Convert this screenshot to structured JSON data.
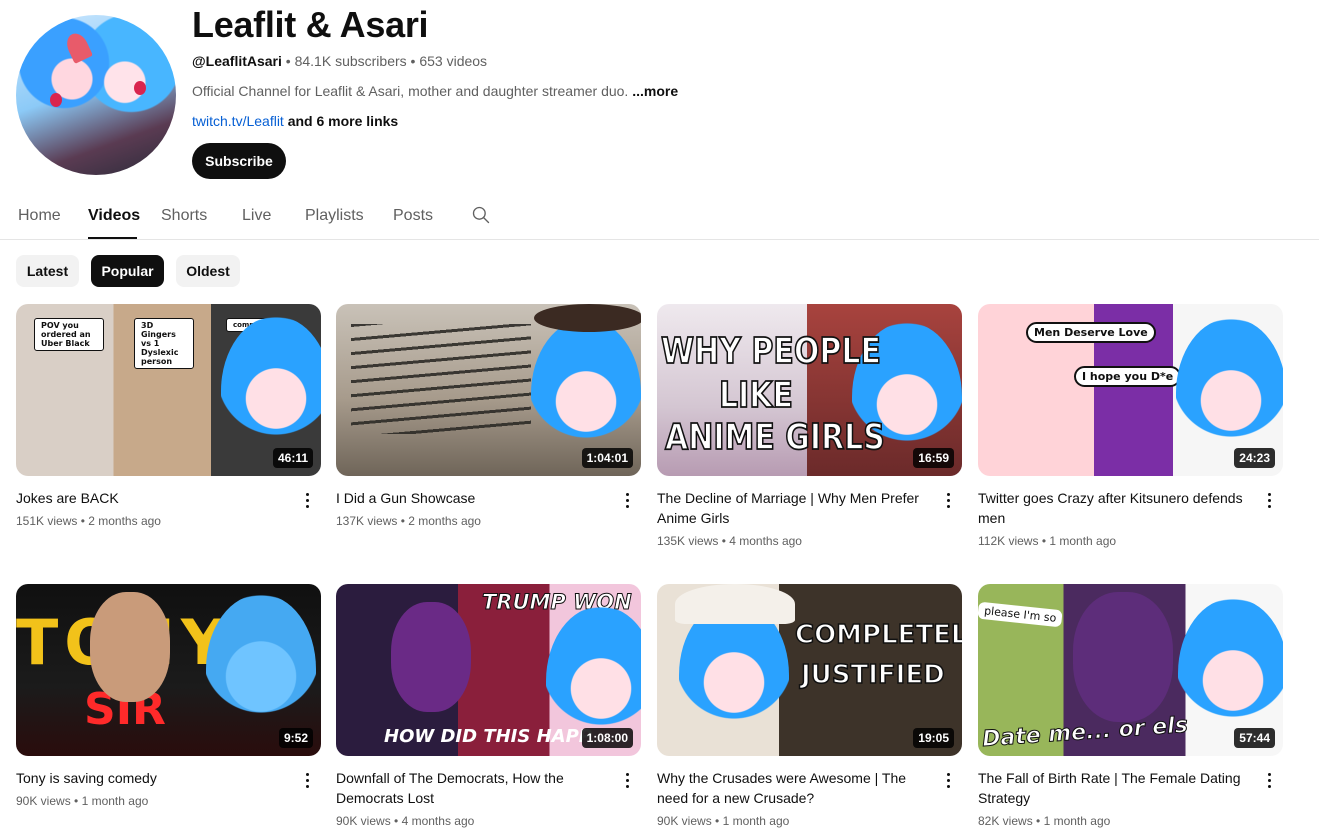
{
  "channel": {
    "name": "Leaflit & Asari",
    "handle": "@LeaflitAsari",
    "subscribers": "84.1K subscribers",
    "videos_count": "653 videos",
    "separator": " • ",
    "description": "Official Channel for Leaflit & Asari, mother and daughter streamer duo.",
    "more_label": "...more",
    "link_text": "twitch.tv/Leaflit",
    "more_links": " and 6 more links",
    "subscribe_label": "Subscribe"
  },
  "tabs": [
    {
      "label": "Home"
    },
    {
      "label": "Videos",
      "active": true
    },
    {
      "label": "Shorts"
    },
    {
      "label": "Live"
    },
    {
      "label": "Playlists"
    },
    {
      "label": "Posts"
    }
  ],
  "chips": [
    {
      "label": "Latest"
    },
    {
      "label": "Popular",
      "active": true
    },
    {
      "label": "Oldest"
    }
  ],
  "videos": [
    {
      "title": "Jokes are BACK",
      "views": "151K views",
      "age": "2 months ago",
      "duration": "46:11",
      "thumb_text": [
        "POV you ordered an Uber Black",
        "3D Gingers vs 1 Dyslexic person",
        "companie pointless"
      ]
    },
    {
      "title": "I Did a Gun Showcase",
      "views": "137K views",
      "age": "2 months ago",
      "duration": "1:04:01"
    },
    {
      "title": "The Decline of Marriage | Why Men Prefer Anime Girls",
      "views": "135K views",
      "age": "4 months ago",
      "duration": "16:59",
      "thumb_text": [
        "WHY PEOPLE",
        "LIKE",
        "ANIME GIRLS"
      ]
    },
    {
      "title": "Twitter goes Crazy after Kitsunero defends men",
      "views": "112K views",
      "age": "1 month ago",
      "duration": "24:23",
      "thumb_text": [
        "Men Deserve Love",
        "I hope you D*e"
      ]
    },
    {
      "title": "Tony is saving comedy",
      "views": "90K views",
      "age": "1 month ago",
      "duration": "9:52",
      "thumb_text": [
        "TONY",
        "SIR"
      ]
    },
    {
      "title": "Downfall of The Democrats, How the Democrats Lost",
      "views": "90K views",
      "age": "4 months ago",
      "duration": "1:08:00",
      "thumb_text": [
        "TRUMP WON",
        "HOW DID THIS HAPP"
      ]
    },
    {
      "title": "Why the Crusades were Awesome | The need for a new Crusade?",
      "views": "90K views",
      "age": "1 month ago",
      "duration": "19:05",
      "thumb_text": [
        "COMPLETELY",
        "JUSTIFIED"
      ]
    },
    {
      "title": "The Fall of Birth Rate | The Female Dating Strategy",
      "views": "82K views",
      "age": "1 month ago",
      "duration": "57:44",
      "thumb_text": [
        "please I'm so",
        "Date me... or els"
      ]
    }
  ],
  "colors": {
    "link": "#065fd4",
    "text": "#0f0f0f",
    "secondary": "#606060",
    "chip_bg": "#f2f2f2"
  },
  "icons": {
    "search_tab": "search-icon",
    "menu": "kebab-menu-icon"
  }
}
